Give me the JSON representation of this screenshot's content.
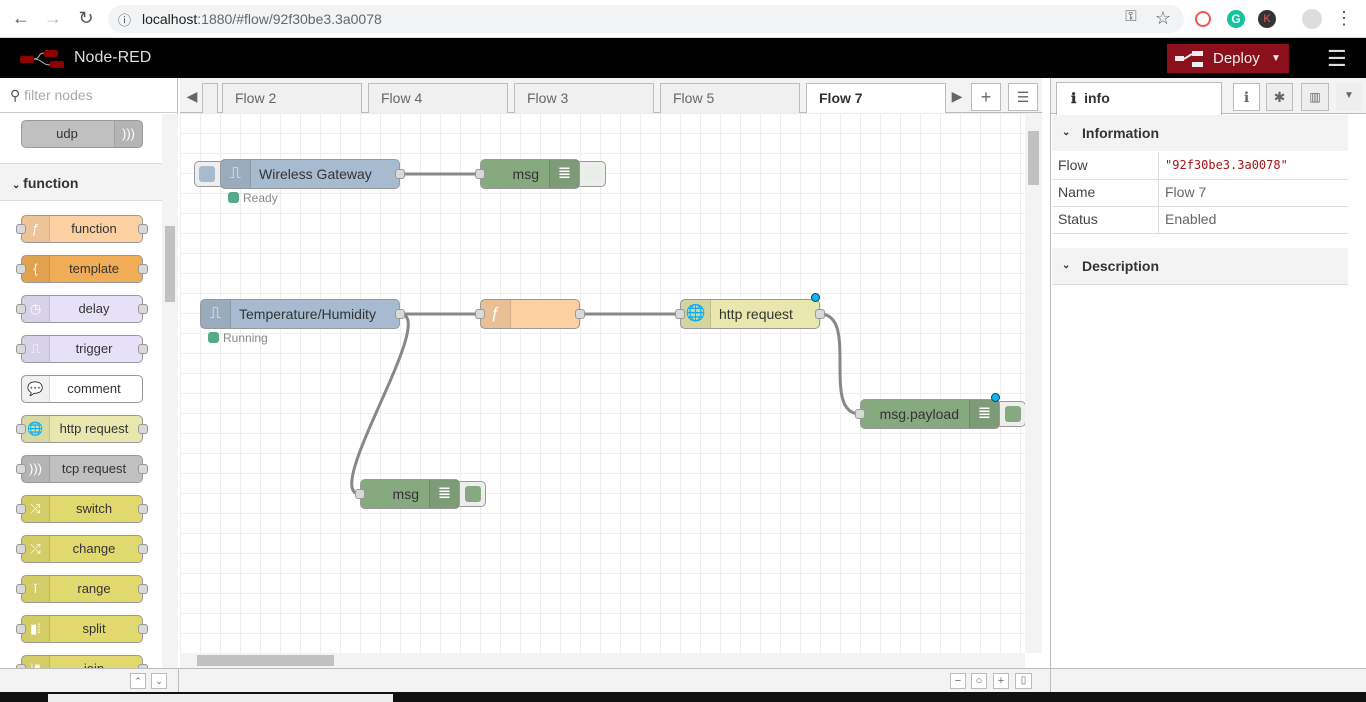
{
  "browser": {
    "url_host": "localhost",
    "url_path": ":1880/#flow/92f30be3.3a0078",
    "icons": [
      "back-icon",
      "forward-icon",
      "reload-icon",
      "info-icon",
      "key-icon",
      "star-icon",
      "extension-icon",
      "grammarly-icon",
      "k-extension-icon",
      "profile-icon",
      "more-icon"
    ]
  },
  "header": {
    "title": "Node-RED",
    "deploy_label": "Deploy",
    "menu_icon": "hamburger-icon",
    "accent": "#8c101c"
  },
  "palette": {
    "filter_placeholder": "filter nodes",
    "top_node": {
      "label": "udp",
      "color": "#c0c0c0"
    },
    "section": "function",
    "nodes": [
      {
        "label": "function",
        "color": "#fdd0a2",
        "icon": "ƒ"
      },
      {
        "label": "template",
        "color": "#f0ad55",
        "icon": "{"
      },
      {
        "label": "delay",
        "color": "#e6e0f8",
        "icon": "◷"
      },
      {
        "label": "trigger",
        "color": "#e6e0f8",
        "icon": "⎍"
      },
      {
        "label": "comment",
        "color": "#ffffff",
        "icon": "💬"
      },
      {
        "label": "http request",
        "color": "#e7e7ae",
        "icon": "🌐"
      },
      {
        "label": "tcp request",
        "color": "#c0c0c0",
        "icon": ")))"
      },
      {
        "label": "switch",
        "color": "#e2d96e",
        "icon": "⤨"
      },
      {
        "label": "change",
        "color": "#e2d96e",
        "icon": "⤭"
      },
      {
        "label": "range",
        "color": "#e2d96e",
        "icon": "ǐ"
      },
      {
        "label": "split",
        "color": "#e2d96e",
        "icon": "▮⁞"
      },
      {
        "label": "join",
        "color": "#e2d96e",
        "icon": "⁞▮"
      }
    ]
  },
  "tabs": [
    {
      "label": "Flow 2"
    },
    {
      "label": "Flow 4"
    },
    {
      "label": "Flow 3"
    },
    {
      "label": "Flow 5"
    },
    {
      "label": "Flow 7",
      "active": true
    }
  ],
  "flow": {
    "nodes": [
      {
        "label": "Wireless Gateway",
        "type": "inject",
        "color": "#a6bbcf",
        "status": "Ready"
      },
      {
        "label": "msg",
        "type": "debug",
        "color": "#87a980"
      },
      {
        "label": "Temperature/Humidity",
        "type": "input",
        "color": "#a6bbcf",
        "status": "Running"
      },
      {
        "label": "",
        "type": "function",
        "color": "#fdd0a2"
      },
      {
        "label": "http request",
        "type": "http request",
        "color": "#e7e7ae",
        "changed": true
      },
      {
        "label": "msg.payload",
        "type": "debug",
        "color": "#87a980",
        "changed": true
      },
      {
        "label": "msg",
        "type": "debug",
        "color": "#87a980"
      }
    ],
    "status_color": "#55aa88"
  },
  "sidebar": {
    "tab_label": "info",
    "information_title": "Information",
    "rows": [
      {
        "key": "Flow",
        "value": "\"92f30be3.3a0078\""
      },
      {
        "key": "Name",
        "value": "Flow 7"
      },
      {
        "key": "Status",
        "value": "Enabled"
      }
    ],
    "description_title": "Description"
  }
}
